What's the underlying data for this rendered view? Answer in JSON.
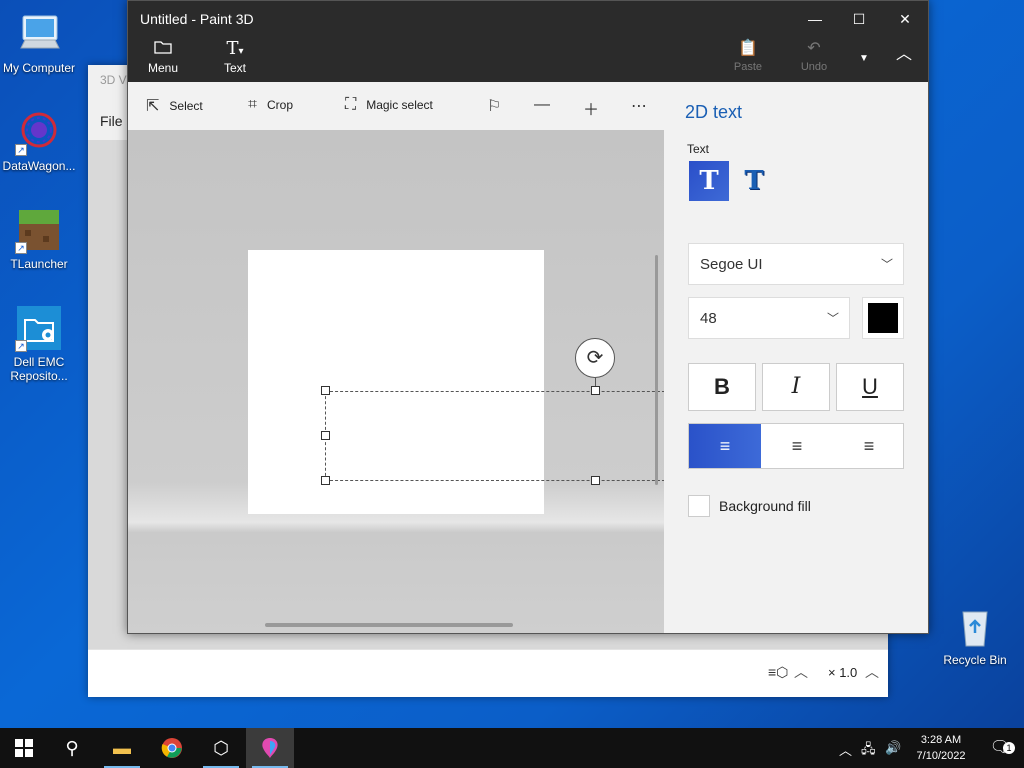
{
  "desktop": {
    "icons": [
      {
        "label": "My Computer"
      },
      {
        "label": "DataWagon..."
      },
      {
        "label": "TLauncher"
      },
      {
        "label": "Dell EMC Reposito..."
      },
      {
        "label": "Recycle Bin"
      }
    ]
  },
  "bg_window": {
    "title": "3D Vi",
    "menu_file": "File",
    "zoom": "× 1.0"
  },
  "paint": {
    "title": "Untitled - Paint 3D",
    "menu_label": "Menu",
    "text_label": "Text",
    "paste_label": "Paste",
    "undo_label": "Undo",
    "toolbar": {
      "select": "Select",
      "crop": "Crop",
      "magic_select": "Magic select"
    },
    "panel": {
      "heading": "2D text",
      "text_label": "Text",
      "font": "Segoe UI",
      "size": "48",
      "bold": "B",
      "italic": "I",
      "underline": "U",
      "background_fill": "Background fill",
      "color": "#000000"
    }
  },
  "taskbar": {
    "time": "3:28 AM",
    "date": "7/10/2022",
    "notification_count": "1"
  }
}
